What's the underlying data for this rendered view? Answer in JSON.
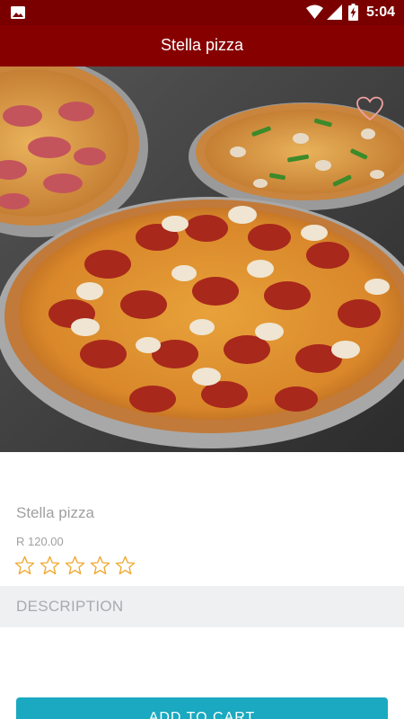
{
  "status_bar": {
    "time": "5:04",
    "icons": [
      "gallery-icon",
      "wifi-icon",
      "signal-icon",
      "battery-charging-icon"
    ]
  },
  "app_bar": {
    "title": "Stella pizza"
  },
  "hero": {
    "image": "pizza-photo",
    "favorite_icon": "heart-outline-icon"
  },
  "product": {
    "name": "Stella pizza",
    "price": "R 120.00",
    "rating": 0,
    "rating_max": 5
  },
  "description": {
    "header": "DESCRIPTION"
  },
  "actions": {
    "add_to_cart": "ADD TO CART"
  },
  "colors": {
    "status_bar": "#7a0000",
    "app_bar": "#870000",
    "accent_button": "#1aa9c0",
    "star_outline": "#f0a830",
    "muted_text": "#a0a0a0",
    "section_bg": "#eef0f2"
  }
}
